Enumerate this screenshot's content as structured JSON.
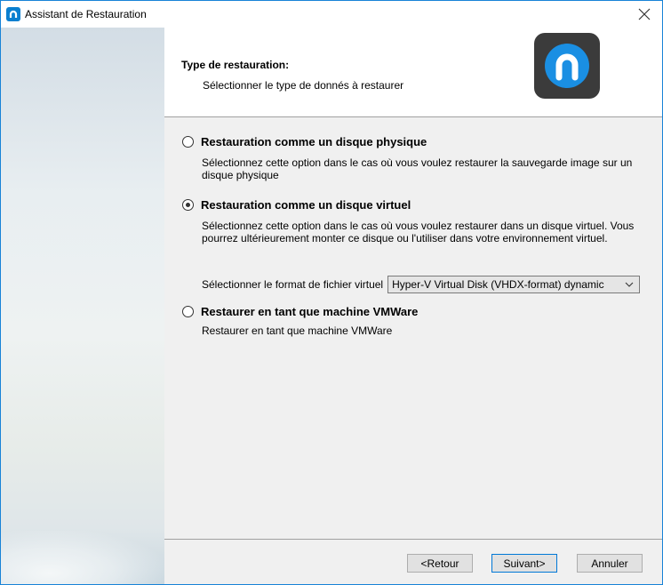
{
  "window": {
    "title": "Assistant de Restauration",
    "close_glyph": "✕"
  },
  "header": {
    "title": "Type de restauration:",
    "subtitle": "Sélectionner le type de donnés à restaurer",
    "logo_icon": "app-logo-icon"
  },
  "options": [
    {
      "label": "Restauration comme un disque physique",
      "selected": false,
      "description": "Sélectionnez cette option dans le cas où vous voulez restaurer la sauvegarde image sur un disque physique"
    },
    {
      "label": "Restauration comme un disque virtuel",
      "selected": true,
      "description": "Sélectionnez cette option dans le cas où vous voulez restaurer dans un disque virtuel. Vous pourrez ultérieurement monter ce disque ou l'utiliser dans votre environnement virtuel."
    },
    {
      "label": "Restaurer en tant que machine VMWare",
      "selected": false,
      "description": "Restaurer en tant que machine VMWare"
    }
  ],
  "format": {
    "label": "Sélectionner le format de fichier virtuel",
    "selected_value": "Hyper-V Virtual Disk (VHDX-format) dynamic"
  },
  "buttons": {
    "back": "<Retour",
    "next": "Suivant>",
    "cancel": "Annuler"
  },
  "colors": {
    "accent": "#0078d7",
    "logo_bg": "#3b3b3b",
    "logo_ring": "#1a8fe3"
  }
}
